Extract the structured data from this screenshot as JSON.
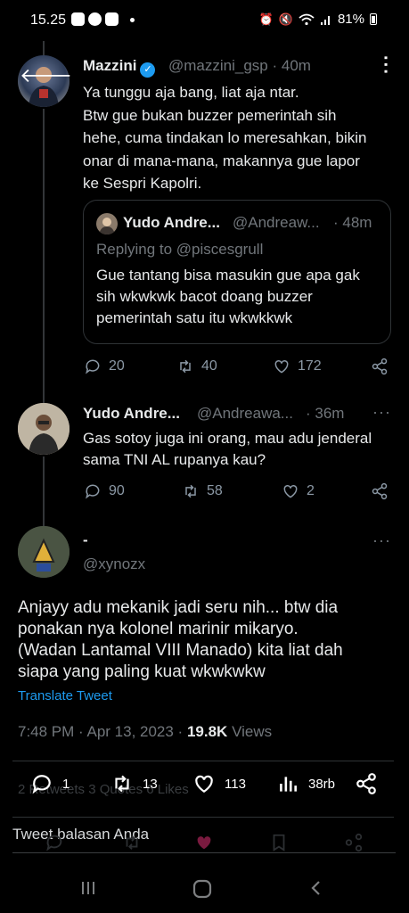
{
  "status_bar": {
    "time": "15.25",
    "battery": "81%"
  },
  "tweet1": {
    "display_name": "Mazzini",
    "handle": "@mazzini_gsp",
    "time": "· 40m",
    "text_lines": [
      "Ya tunggu aja bang, liat aja ntar.",
      "Btw gue bukan buzzer pemerintah sih",
      "hehe, cuma tindakan lo meresahkan, bikin",
      "onar di mana-mana, makannya gue lapor",
      "ke Sespri Kapolri."
    ],
    "quote": {
      "display_name": "Yudo Andre...",
      "handle": "@Andreaw...",
      "time": "· 48m",
      "replying_to": "Replying to @piscesgrull",
      "text_lines": [
        "Gue tantang bisa masukin gue apa gak",
        "sih wkwkwk bacot doang buzzer",
        "pemerintah satu itu wkwkkwk"
      ]
    },
    "replies": "20",
    "retweets": "40",
    "likes": "172"
  },
  "tweet2": {
    "display_name": "Yudo Andre...",
    "handle": "@Andreawa...",
    "time": "· 36m",
    "text_lines": [
      "Gas sotoy juga ini orang, mau adu jenderal",
      "sama TNI AL rupanya kau?"
    ],
    "replies": "90",
    "retweets": "58",
    "likes": "2"
  },
  "main_tweet": {
    "display_name": "-",
    "handle": "@xynozx",
    "text_lines": [
      "Anjayy adu mekanik jadi seru nih... btw dia",
      "ponakan nya kolonel marinir mikaryo.",
      "(Wadan Lantamal VIII Manado) kita liat dah",
      "siapa yang paling kuat wkwkwkw"
    ],
    "translate_label": "Translate Tweet",
    "timestamp": "7:48 PM · Apr 13, 2023 ·",
    "views_count": "19.8K",
    "views_label": "Views",
    "ghost_stats": "2 Retweets   3 Quotes   6 Likes",
    "replies": "1",
    "retweets": "13",
    "likes": "113",
    "views_short": "38rb"
  },
  "reply_placeholder": "Tweet balasan Anda",
  "colors": {
    "background": "#000000",
    "text": "#e7e9ea",
    "muted": "#71767b",
    "accent": "#1d9bf0",
    "like_pink": "#f91880"
  }
}
